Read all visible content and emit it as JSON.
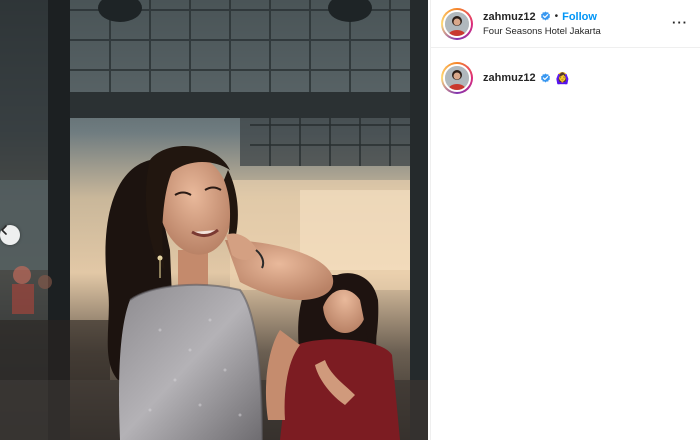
{
  "post": {
    "username": "zahmuz12",
    "separator": "•",
    "follow_label": "Follow",
    "location": "Four Seasons Hotel Jakarta",
    "more_label": "···"
  },
  "caption": {
    "username": "zahmuz12",
    "emoji": "🙆‍♀️"
  },
  "colors": {
    "follow_blue": "#0095f6",
    "verified_blue": "#3897f0",
    "text": "#262626",
    "divider": "#efefef"
  },
  "icons": {
    "verified": "verified-badge-icon",
    "carousel_prev": "chevron-left-icon"
  }
}
